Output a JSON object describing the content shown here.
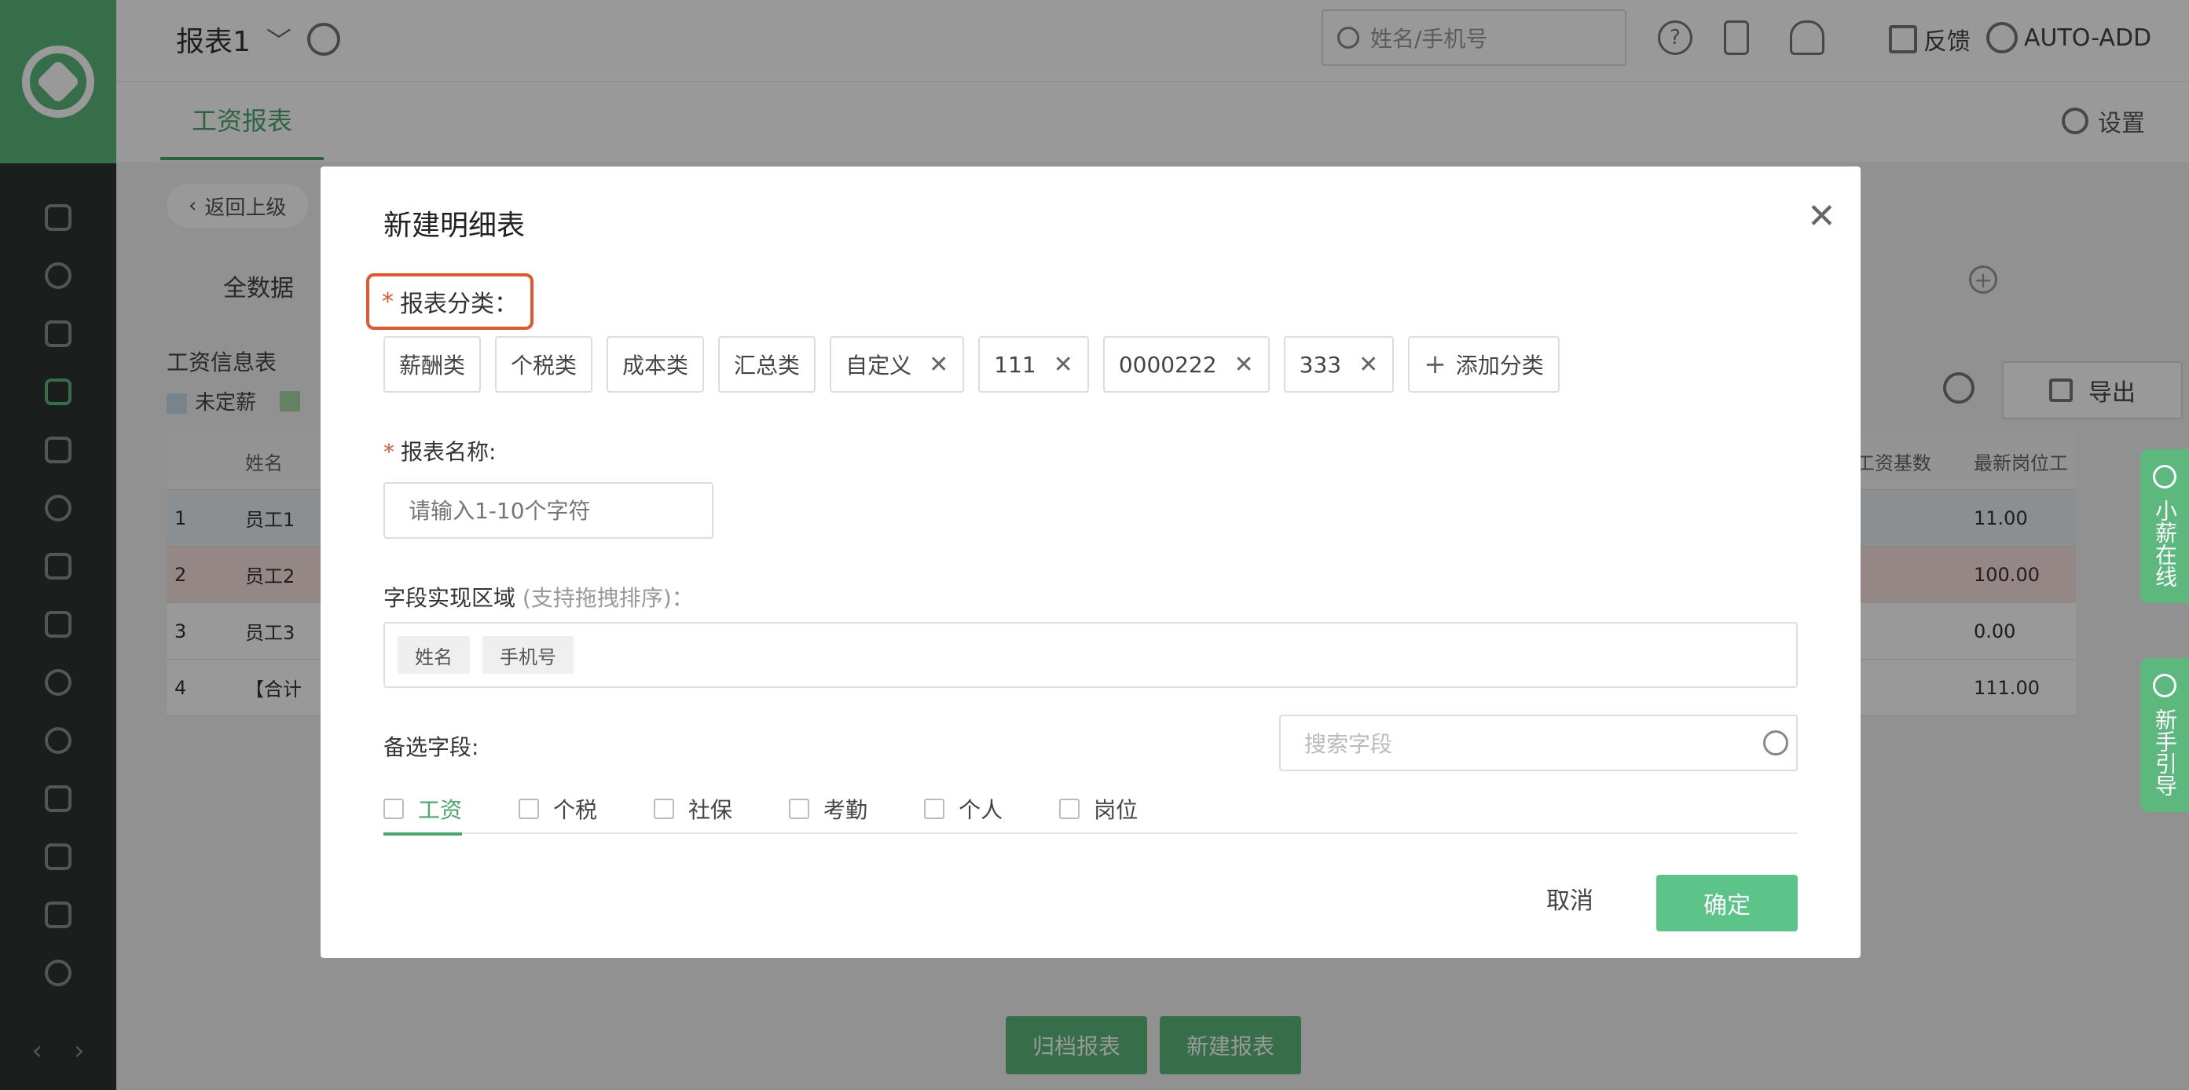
{
  "header": {
    "report_title": "报表1",
    "search_placeholder": "姓名/手机号",
    "help_glyph": "?",
    "feedback": "反馈",
    "user": "AUTO-ADD"
  },
  "tabs": {
    "active": "工资报表",
    "settings": "设置"
  },
  "content": {
    "back": "返回上级",
    "all_data": "全数据",
    "info_title": "工资信息表",
    "legend": [
      {
        "label": "未定薪",
        "color": "#c9dcea"
      },
      {
        "label": "",
        "color": "#a9d7a7"
      }
    ],
    "export": "导出",
    "table": {
      "col_name": "姓名",
      "col_right1": "工资基数",
      "col_right2": "最新岗位工",
      "rows": [
        {
          "no": "1",
          "name": "员工1",
          "val": "11.00"
        },
        {
          "no": "2",
          "name": "员工2",
          "val": "100.00"
        },
        {
          "no": "3",
          "name": "员工3",
          "val": "0.00"
        },
        {
          "no": "4",
          "name": "【合计",
          "val": "111.00"
        }
      ]
    },
    "archive_btn": "归档报表",
    "new_btn": "新建报表"
  },
  "side_widgets": {
    "online": "小薪在线",
    "guide": "新手引导"
  },
  "modal": {
    "title": "新建明细表",
    "category_label": "报表分类：",
    "categories": [
      {
        "label": "薪酬类",
        "removable": false
      },
      {
        "label": "个税类",
        "removable": false
      },
      {
        "label": "成本类",
        "removable": false
      },
      {
        "label": "汇总类",
        "removable": false
      },
      {
        "label": "自定义",
        "removable": true
      },
      {
        "label": "111",
        "removable": true
      },
      {
        "label": "0000222",
        "removable": true
      },
      {
        "label": "333",
        "removable": true
      }
    ],
    "add_category": "添加分类",
    "name_label": "报表名称:",
    "name_placeholder": "请输入1-10个字符",
    "field_area_label": "字段实现区域",
    "field_area_hint": "(支持拖拽排序)：",
    "field_chips": [
      "姓名",
      "手机号"
    ],
    "spare_label": "备选字段:",
    "search_field_placeholder": "搜索字段",
    "field_tabs": [
      "工资",
      "个税",
      "社保",
      "考勤",
      "个人",
      "岗位"
    ],
    "cancel": "取消",
    "confirm": "确定"
  }
}
